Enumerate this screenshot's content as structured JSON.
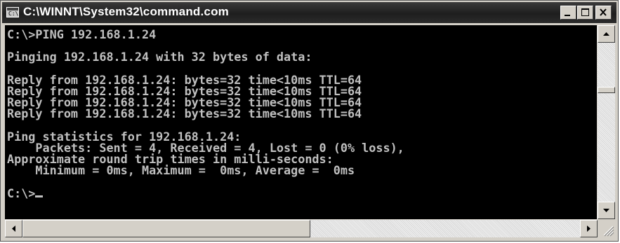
{
  "window": {
    "title": "C:\\WINNT\\System32\\command.com",
    "icon": "console-app-icon",
    "icon_glyph": "C:\\"
  },
  "controls": {
    "minimize_icon": "minimize-icon",
    "maximize_icon": "maximize-icon",
    "close_icon": "close-icon"
  },
  "console": {
    "lines": [
      "C:\\>PING 192.168.1.24",
      "",
      "Pinging 192.168.1.24 with 32 bytes of data:",
      "",
      "Reply from 192.168.1.24: bytes=32 time<10ms TTL=64",
      "Reply from 192.168.1.24: bytes=32 time<10ms TTL=64",
      "Reply from 192.168.1.24: bytes=32 time<10ms TTL=64",
      "Reply from 192.168.1.24: bytes=32 time<10ms TTL=64",
      "",
      "Ping statistics for 192.168.1.24:",
      "    Packets: Sent = 4, Received = 4, Lost = 0 (0% loss),",
      "Approximate round trip times in milli-seconds:",
      "    Minimum = 0ms, Maximum =  0ms, Average =  0ms",
      "",
      "C:\\>"
    ],
    "text_color": "#c0c0c0",
    "background_color": "#000000"
  },
  "scrollbars": {
    "up_icon": "arrow-up-icon",
    "down_icon": "arrow-down-icon",
    "left_icon": "arrow-left-icon",
    "right_icon": "arrow-right-icon",
    "grip_icon": "resize-grip-icon"
  }
}
